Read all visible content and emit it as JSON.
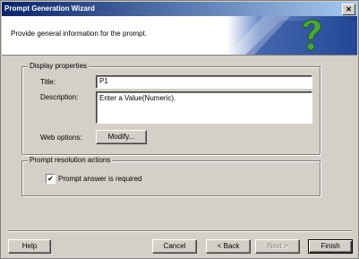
{
  "window": {
    "title": "Prompt Generation Wizard",
    "close_glyph": "✕"
  },
  "header": {
    "subtitle": "Provide general information for the prompt."
  },
  "display_properties": {
    "legend": "Display properties",
    "title_label": "Title:",
    "title_value": "P1",
    "description_label": "Description:",
    "description_value": "Enter a Value(Numeric).",
    "web_options_label": "Web options:",
    "modify_button": "Modify..."
  },
  "prompt_resolution": {
    "legend": "Prompt resolution actions",
    "required_label": "Prompt answer is required",
    "required_checked": true
  },
  "footer": {
    "help": "Help",
    "cancel": "Cancel",
    "back": "< Back",
    "next": "Next >",
    "finish": "Finish"
  }
}
